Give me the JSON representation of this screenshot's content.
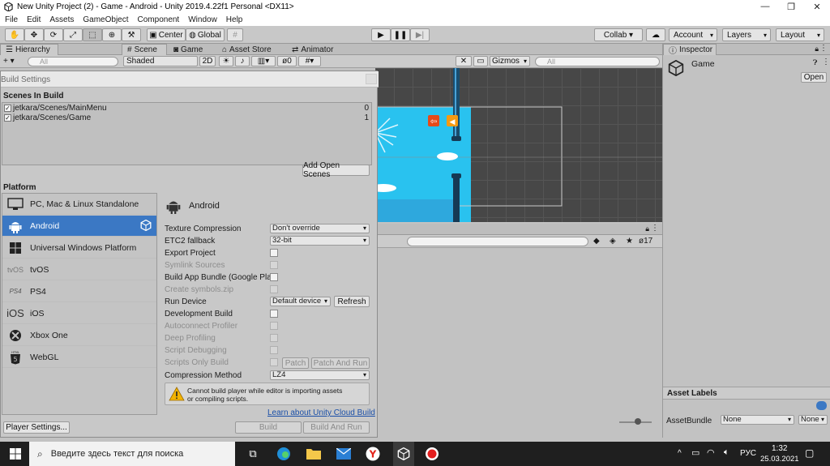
{
  "window": {
    "title": "New Unity Project (2) - Game - Android - Unity 2019.4.22f1 Personal <DX11>",
    "minimize": "—",
    "maximize": "❐",
    "close": "✕"
  },
  "menu": [
    "File",
    "Edit",
    "Assets",
    "GameObject",
    "Component",
    "Window",
    "Help"
  ],
  "toolbar": {
    "pivot_label": "Center",
    "space_label": "Global",
    "collab_label": "Collab ▾",
    "account_label": "Account",
    "layers_label": "Layers",
    "layout_label": "Layout"
  },
  "hierarchy": {
    "tab": "Hierarchy",
    "add": "+ ▾",
    "search_placeholder": "All"
  },
  "scene_view": {
    "tabs": [
      "Scene",
      "Game",
      "Asset Store",
      "Animator"
    ],
    "shading": "Shaded",
    "mode_2d": "2D",
    "hidden_count": "0",
    "gizmos": "Gizmos",
    "search_placeholder": "All"
  },
  "build_settings": {
    "title": "Build Settings",
    "scenes_header": "Scenes In Build",
    "scenes": [
      {
        "path": "jetkara/Scenes/MainMenu",
        "index": "0"
      },
      {
        "path": "jetkara/Scenes/Game",
        "index": "1"
      }
    ],
    "add_open_scenes": "Add Open Scenes",
    "platform_header": "Platform",
    "platforms": [
      {
        "label": "PC, Mac & Linux Standalone",
        "icon": "monitor-icon"
      },
      {
        "label": "Android",
        "icon": "android-icon"
      },
      {
        "label": "Universal Windows Platform",
        "icon": "windows-icon"
      },
      {
        "label": "tvOS",
        "icon": "tvos-icon"
      },
      {
        "label": "PS4",
        "icon": "ps4-icon"
      },
      {
        "label": "iOS",
        "icon": "ios-icon"
      },
      {
        "label": "Xbox One",
        "icon": "xbox-icon"
      },
      {
        "label": "WebGL",
        "icon": "html5-icon"
      }
    ],
    "platform_icon_text": {
      "tvos": "tvOS",
      "ps4": "PS4",
      "ios": "iOS",
      "html5": "HTML"
    },
    "selected_platform": "Android",
    "options": {
      "texture_compression_label": "Texture Compression",
      "texture_compression_value": "Don't override",
      "etc2_label": "ETC2 fallback",
      "etc2_value": "32-bit",
      "export_project": "Export Project",
      "symlink_sources": "Symlink Sources",
      "build_app_bundle": "Build App Bundle (Google Play)",
      "create_symbols": "Create symbols.zip",
      "run_device_label": "Run Device",
      "run_device_value": "Default device",
      "refresh": "Refresh",
      "development_build": "Development Build",
      "autoconnect_profiler": "Autoconnect Profiler",
      "deep_profiling": "Deep Profiling",
      "script_debugging": "Script Debugging",
      "scripts_only_build": "Scripts Only Build",
      "patch": "Patch",
      "patch_and_run": "Patch And Run",
      "compression_label": "Compression Method",
      "compression_value": "LZ4"
    },
    "warning": "Cannot build player while editor is importing assets or compiling scripts.",
    "cloud_link": "Learn about Unity Cloud Build",
    "player_settings": "Player Settings...",
    "build": "Build",
    "build_and_run": "Build And Run"
  },
  "console": {
    "count": "17"
  },
  "inspector": {
    "tab": "Inspector",
    "object_name": "Game",
    "open_button": "Open",
    "asset_labels": "Asset Labels",
    "asset_bundle_label": "AssetBundle",
    "asset_bundle_value": "None",
    "variant_value": "None"
  },
  "taskbar": {
    "search_placeholder": "Введите здесь текст для поиска",
    "language": "РУС",
    "time": "1:32",
    "date": "25.03.2021"
  },
  "colors": {
    "selection": "#3b78c4",
    "sky": "#29c2ef",
    "link": "#1a4fa8"
  }
}
